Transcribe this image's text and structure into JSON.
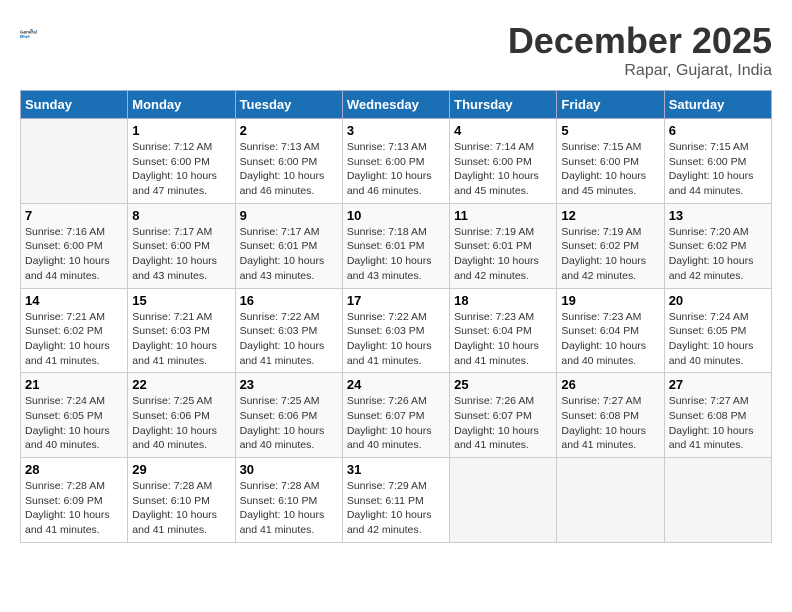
{
  "header": {
    "logo_line1": "General",
    "logo_line2": "Blue",
    "month": "December 2025",
    "location": "Rapar, Gujarat, India"
  },
  "weekdays": [
    "Sunday",
    "Monday",
    "Tuesday",
    "Wednesday",
    "Thursday",
    "Friday",
    "Saturday"
  ],
  "weeks": [
    [
      {
        "day": "",
        "sunrise": "",
        "sunset": "",
        "daylight": ""
      },
      {
        "day": "1",
        "sunrise": "Sunrise: 7:12 AM",
        "sunset": "Sunset: 6:00 PM",
        "daylight": "Daylight: 10 hours and 47 minutes."
      },
      {
        "day": "2",
        "sunrise": "Sunrise: 7:13 AM",
        "sunset": "Sunset: 6:00 PM",
        "daylight": "Daylight: 10 hours and 46 minutes."
      },
      {
        "day": "3",
        "sunrise": "Sunrise: 7:13 AM",
        "sunset": "Sunset: 6:00 PM",
        "daylight": "Daylight: 10 hours and 46 minutes."
      },
      {
        "day": "4",
        "sunrise": "Sunrise: 7:14 AM",
        "sunset": "Sunset: 6:00 PM",
        "daylight": "Daylight: 10 hours and 45 minutes."
      },
      {
        "day": "5",
        "sunrise": "Sunrise: 7:15 AM",
        "sunset": "Sunset: 6:00 PM",
        "daylight": "Daylight: 10 hours and 45 minutes."
      },
      {
        "day": "6",
        "sunrise": "Sunrise: 7:15 AM",
        "sunset": "Sunset: 6:00 PM",
        "daylight": "Daylight: 10 hours and 44 minutes."
      }
    ],
    [
      {
        "day": "7",
        "sunrise": "Sunrise: 7:16 AM",
        "sunset": "Sunset: 6:00 PM",
        "daylight": "Daylight: 10 hours and 44 minutes."
      },
      {
        "day": "8",
        "sunrise": "Sunrise: 7:17 AM",
        "sunset": "Sunset: 6:00 PM",
        "daylight": "Daylight: 10 hours and 43 minutes."
      },
      {
        "day": "9",
        "sunrise": "Sunrise: 7:17 AM",
        "sunset": "Sunset: 6:01 PM",
        "daylight": "Daylight: 10 hours and 43 minutes."
      },
      {
        "day": "10",
        "sunrise": "Sunrise: 7:18 AM",
        "sunset": "Sunset: 6:01 PM",
        "daylight": "Daylight: 10 hours and 43 minutes."
      },
      {
        "day": "11",
        "sunrise": "Sunrise: 7:19 AM",
        "sunset": "Sunset: 6:01 PM",
        "daylight": "Daylight: 10 hours and 42 minutes."
      },
      {
        "day": "12",
        "sunrise": "Sunrise: 7:19 AM",
        "sunset": "Sunset: 6:02 PM",
        "daylight": "Daylight: 10 hours and 42 minutes."
      },
      {
        "day": "13",
        "sunrise": "Sunrise: 7:20 AM",
        "sunset": "Sunset: 6:02 PM",
        "daylight": "Daylight: 10 hours and 42 minutes."
      }
    ],
    [
      {
        "day": "14",
        "sunrise": "Sunrise: 7:21 AM",
        "sunset": "Sunset: 6:02 PM",
        "daylight": "Daylight: 10 hours and 41 minutes."
      },
      {
        "day": "15",
        "sunrise": "Sunrise: 7:21 AM",
        "sunset": "Sunset: 6:03 PM",
        "daylight": "Daylight: 10 hours and 41 minutes."
      },
      {
        "day": "16",
        "sunrise": "Sunrise: 7:22 AM",
        "sunset": "Sunset: 6:03 PM",
        "daylight": "Daylight: 10 hours and 41 minutes."
      },
      {
        "day": "17",
        "sunrise": "Sunrise: 7:22 AM",
        "sunset": "Sunset: 6:03 PM",
        "daylight": "Daylight: 10 hours and 41 minutes."
      },
      {
        "day": "18",
        "sunrise": "Sunrise: 7:23 AM",
        "sunset": "Sunset: 6:04 PM",
        "daylight": "Daylight: 10 hours and 41 minutes."
      },
      {
        "day": "19",
        "sunrise": "Sunrise: 7:23 AM",
        "sunset": "Sunset: 6:04 PM",
        "daylight": "Daylight: 10 hours and 40 minutes."
      },
      {
        "day": "20",
        "sunrise": "Sunrise: 7:24 AM",
        "sunset": "Sunset: 6:05 PM",
        "daylight": "Daylight: 10 hours and 40 minutes."
      }
    ],
    [
      {
        "day": "21",
        "sunrise": "Sunrise: 7:24 AM",
        "sunset": "Sunset: 6:05 PM",
        "daylight": "Daylight: 10 hours and 40 minutes."
      },
      {
        "day": "22",
        "sunrise": "Sunrise: 7:25 AM",
        "sunset": "Sunset: 6:06 PM",
        "daylight": "Daylight: 10 hours and 40 minutes."
      },
      {
        "day": "23",
        "sunrise": "Sunrise: 7:25 AM",
        "sunset": "Sunset: 6:06 PM",
        "daylight": "Daylight: 10 hours and 40 minutes."
      },
      {
        "day": "24",
        "sunrise": "Sunrise: 7:26 AM",
        "sunset": "Sunset: 6:07 PM",
        "daylight": "Daylight: 10 hours and 40 minutes."
      },
      {
        "day": "25",
        "sunrise": "Sunrise: 7:26 AM",
        "sunset": "Sunset: 6:07 PM",
        "daylight": "Daylight: 10 hours and 41 minutes."
      },
      {
        "day": "26",
        "sunrise": "Sunrise: 7:27 AM",
        "sunset": "Sunset: 6:08 PM",
        "daylight": "Daylight: 10 hours and 41 minutes."
      },
      {
        "day": "27",
        "sunrise": "Sunrise: 7:27 AM",
        "sunset": "Sunset: 6:08 PM",
        "daylight": "Daylight: 10 hours and 41 minutes."
      }
    ],
    [
      {
        "day": "28",
        "sunrise": "Sunrise: 7:28 AM",
        "sunset": "Sunset: 6:09 PM",
        "daylight": "Daylight: 10 hours and 41 minutes."
      },
      {
        "day": "29",
        "sunrise": "Sunrise: 7:28 AM",
        "sunset": "Sunset: 6:10 PM",
        "daylight": "Daylight: 10 hours and 41 minutes."
      },
      {
        "day": "30",
        "sunrise": "Sunrise: 7:28 AM",
        "sunset": "Sunset: 6:10 PM",
        "daylight": "Daylight: 10 hours and 41 minutes."
      },
      {
        "day": "31",
        "sunrise": "Sunrise: 7:29 AM",
        "sunset": "Sunset: 6:11 PM",
        "daylight": "Daylight: 10 hours and 42 minutes."
      },
      {
        "day": "",
        "sunrise": "",
        "sunset": "",
        "daylight": ""
      },
      {
        "day": "",
        "sunrise": "",
        "sunset": "",
        "daylight": ""
      },
      {
        "day": "",
        "sunrise": "",
        "sunset": "",
        "daylight": ""
      }
    ]
  ]
}
